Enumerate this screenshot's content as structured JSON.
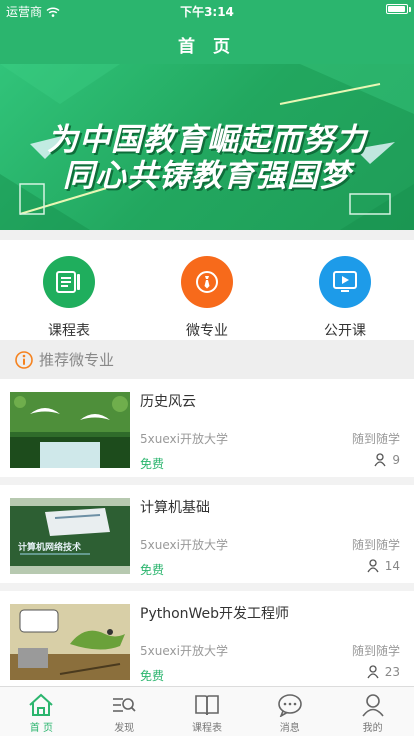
{
  "status_bar": {
    "carrier": "运营商",
    "time": "下午3:14"
  },
  "header": {
    "title": "首 页"
  },
  "banner": {
    "line1": "为中国教育崛起而努力",
    "line2": "同心共铸教育强国梦"
  },
  "categories": [
    {
      "label": "课程表",
      "icon": "schedule-icon",
      "color": "#1fae5d"
    },
    {
      "label": "微专业",
      "icon": "tie-icon",
      "color": "#f76a1b"
    },
    {
      "label": "公开课",
      "icon": "video-icon",
      "color": "#1d9be9"
    }
  ],
  "section": {
    "title": "推荐微专业",
    "icon": "info-icon"
  },
  "courses": [
    {
      "title": "历史风云",
      "school": "5xuexi开放大学",
      "mode": "随到随学",
      "price": "免费",
      "count": "9"
    },
    {
      "title": "计算机基础",
      "school": "5xuexi开放大学",
      "mode": "随到随学",
      "price": "免费",
      "count": "14"
    },
    {
      "title": "PythonWeb开发工程师",
      "school": "5xuexi开放大学",
      "mode": "随到随学",
      "price": "免费",
      "count": "23"
    }
  ],
  "thumb_texts": {
    "computer_cover": "计算机网络技术"
  },
  "tabs": [
    {
      "label": "首 页",
      "icon": "home-icon",
      "active": true
    },
    {
      "label": "发现",
      "icon": "discover-icon",
      "active": false
    },
    {
      "label": "课程表",
      "icon": "book-icon",
      "active": false
    },
    {
      "label": "消息",
      "icon": "message-icon",
      "active": false
    },
    {
      "label": "我的",
      "icon": "profile-icon",
      "active": false
    }
  ],
  "colors": {
    "brand": "#2bb56e",
    "price": "#2bb56e"
  }
}
